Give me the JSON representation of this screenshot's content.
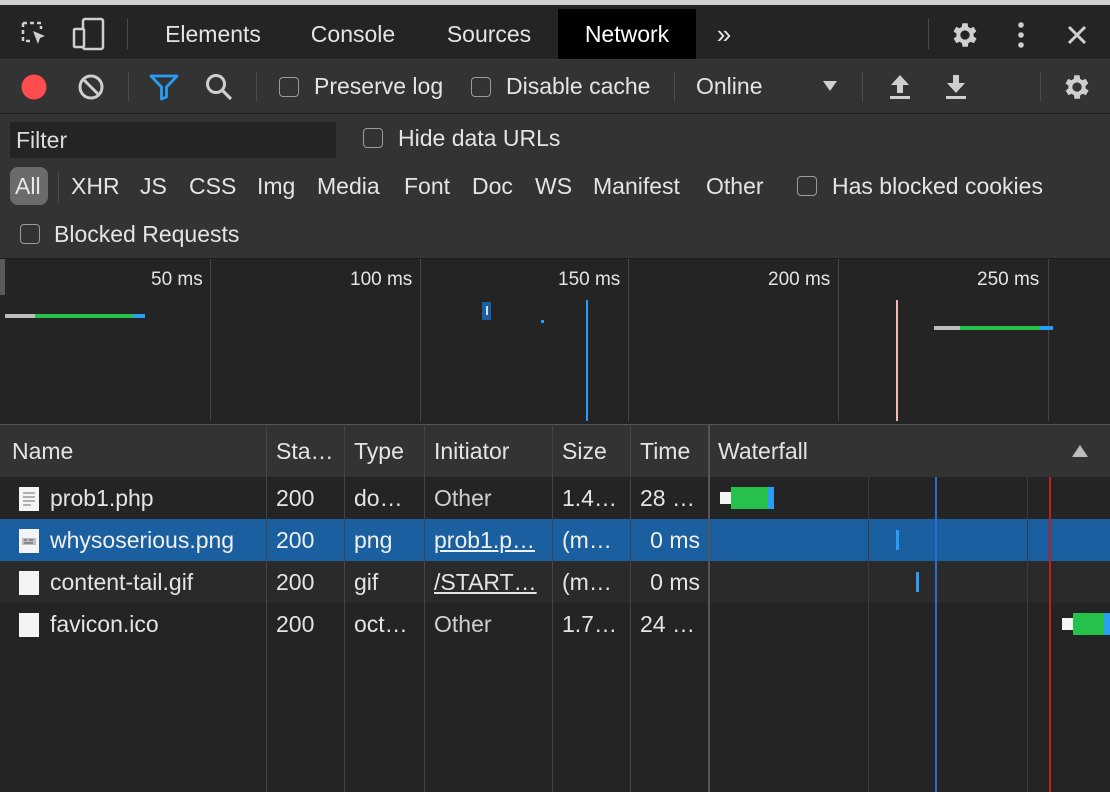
{
  "tabs": [
    {
      "label": "Elements",
      "active": false
    },
    {
      "label": "Console",
      "active": false
    },
    {
      "label": "Sources",
      "active": false
    },
    {
      "label": "Network",
      "active": true
    }
  ],
  "toolbar": {
    "preserve_log": "Preserve log",
    "disable_cache": "Disable cache",
    "throttle": "Online"
  },
  "filter": {
    "placeholder": "Filter",
    "hide_data_urls": "Hide data URLs",
    "types": [
      "All",
      "XHR",
      "JS",
      "CSS",
      "Img",
      "Media",
      "Font",
      "Doc",
      "WS",
      "Manifest",
      "Other"
    ],
    "has_blocked_cookies": "Has blocked cookies",
    "blocked_requests": "Blocked Requests"
  },
  "overview": {
    "labels": [
      "50 ms",
      "100 ms",
      "150 ms",
      "200 ms",
      "250 ms"
    ]
  },
  "table": {
    "columns": [
      "Name",
      "Sta…",
      "Type",
      "Initiator",
      "Size",
      "Time",
      "Waterfall"
    ],
    "rows": [
      {
        "name": "prob1.php",
        "status": "200",
        "type": "do…",
        "initiator": "Other",
        "size": "1.4…",
        "time": "28 …"
      },
      {
        "name": "whysoserious.png",
        "status": "200",
        "type": "png",
        "initiator": "prob1.p…",
        "size": "(m…",
        "time": "0 ms"
      },
      {
        "name": "content-tail.gif",
        "status": "200",
        "type": "gif",
        "initiator": "/START…",
        "size": "(m…",
        "time": "0 ms"
      },
      {
        "name": "favicon.ico",
        "status": "200",
        "type": "oct…",
        "initiator": "Other",
        "size": "1.7…",
        "time": "24 …"
      }
    ]
  },
  "colors": {
    "accent": "#1a5fa0",
    "record": "#ff4d4f",
    "wait": "#26c14d",
    "receive": "#2a9df4"
  }
}
